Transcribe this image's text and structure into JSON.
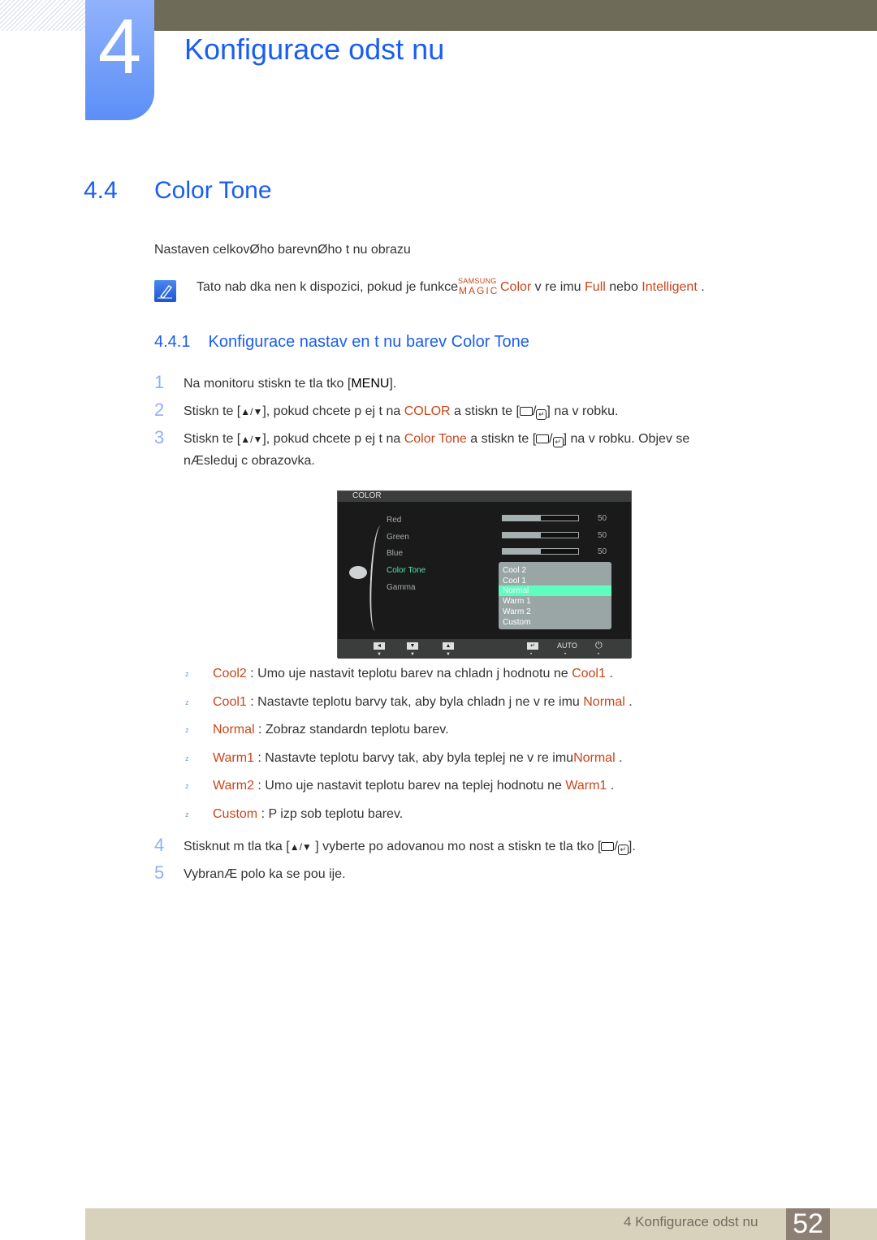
{
  "chapter": {
    "number": "4",
    "title": "Konfigurace odst nu"
  },
  "section": {
    "number": "4.4",
    "title": "Color Tone"
  },
  "intro": "Nastaven  celkovØho barevnØho t nu obrazu",
  "note": {
    "prefix": "Tato nab dka nen  k dispozici, pokud je funkce",
    "magic_top": "SAMSUNG",
    "magic_bottom": "MAGIC",
    "color_word": "Color",
    "mid": " v re imu ",
    "full": "Full",
    "nebo": " nebo ",
    "intelligent": "Intelligent",
    "end": " ."
  },
  "subsection": {
    "number": "4.4.1",
    "title": "Konfigurace nastav en  t nu barev Color Tone"
  },
  "steps": [
    {
      "num": "1",
      "a": "Na monitoru stiskn te tla  tko [",
      "key": "MENU",
      "b": "]."
    },
    {
      "num": "2",
      "a": "Stiskn te [",
      "arrows": "▲/▼",
      "b": "], pokud chcete p ej t na ",
      "hl": "COLOR",
      "c": " a stiskn te [",
      "d": "] na v robku."
    },
    {
      "num": "3",
      "a": "Stiskn te [",
      "arrows": "▲/▼",
      "b": "], pokud chcete p ej t na ",
      "hl": "Color Tone",
      "c": "  a stiskn te [",
      "d": "] na v robku. Objev  se",
      "line2": "nÆsleduj c  obrazovka."
    },
    {
      "num": "4",
      "a": "Stisknut m tla  tka [",
      "arrows": "▲/▼",
      "b": " ] vyberte po adovanou mo nost a stiskn te tla  tko [",
      "d": "]."
    },
    {
      "num": "5",
      "a": "VybranÆ polo ka se pou ije."
    }
  ],
  "osd": {
    "header": "COLOR",
    "items": [
      {
        "label": "Red",
        "value": "50",
        "level": 0.5
      },
      {
        "label": "Green",
        "value": "50",
        "level": 0.5
      },
      {
        "label": "Blue",
        "value": "50",
        "level": 0.5
      },
      {
        "label": "Color Tone",
        "active": true
      },
      {
        "label": "Gamma"
      }
    ],
    "options": [
      "Cool 2",
      "Cool 1",
      "Normal",
      "Warm 1",
      "Warm 2",
      "Custom"
    ],
    "selected_option": "Normal",
    "footer": {
      "left": "◄",
      "down": "▼",
      "up": "▲",
      "enter": "↵",
      "auto": "AUTO",
      "power": "⏻"
    }
  },
  "bullets": [
    {
      "mark": "z",
      "term": "Cool2",
      "text": " : Umo  uje nastavit teplotu barev na chladn j   hodnotu ne   ",
      "ref": "Cool1",
      "end": " ."
    },
    {
      "mark": "z",
      "term": "Cool1",
      "text": " : Nastavte teplotu barvy tak, aby byla chladn j   ne  v re imu ",
      "ref": "Normal",
      "end": " ."
    },
    {
      "mark": "z",
      "term": "Normal",
      "text": " : Zobraz  standardn  teplotu barev.",
      "ref": "",
      "end": ""
    },
    {
      "mark": "z",
      "term": "Warm1",
      "text": " : Nastavte teplotu barvy tak, aby byla teplej   ne  v re imu",
      "ref": "Normal",
      "end": " ."
    },
    {
      "mark": "z",
      "term": "Warm2",
      "text": " : Umo  uje nastavit teplotu barev na teplej   hodnotu ne  ",
      "ref": "Warm1",
      "end": " ."
    },
    {
      "mark": "z",
      "term": "Custom",
      "text": " : P izp sob  teplotu barev.",
      "ref": "",
      "end": ""
    }
  ],
  "footer": {
    "text": "4 Konfigurace odst nu",
    "page": "52"
  }
}
